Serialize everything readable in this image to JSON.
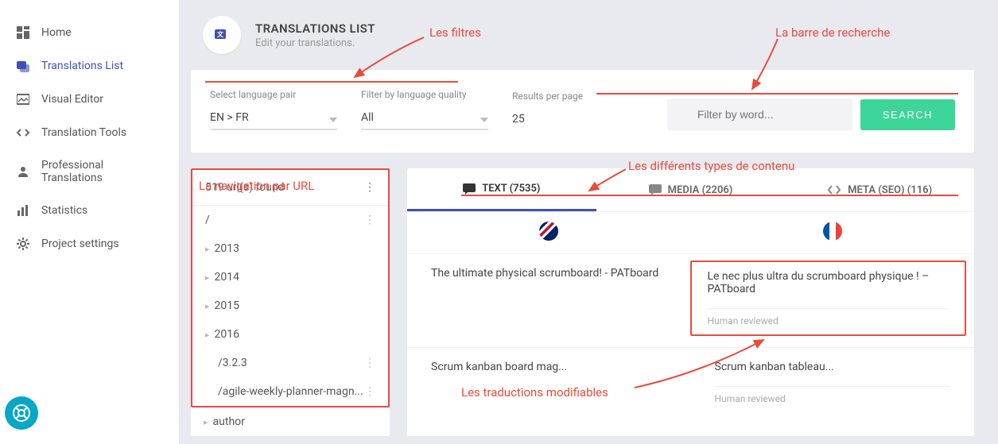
{
  "sidebar": {
    "items": [
      {
        "label": "Home"
      },
      {
        "label": "Translations List"
      },
      {
        "label": "Visual Editor"
      },
      {
        "label": "Translation Tools"
      },
      {
        "label": "Professional Translations"
      },
      {
        "label": "Statistics"
      },
      {
        "label": "Project settings"
      }
    ]
  },
  "header": {
    "title": "TRANSLATIONS LIST",
    "subtitle": "Edit your translations."
  },
  "filters": {
    "language_pair": {
      "label": "Select language pair",
      "value": "EN > FR"
    },
    "quality": {
      "label": "Filter by language quality",
      "value": "All"
    },
    "results": {
      "label": "Results per page",
      "value": "25"
    }
  },
  "search": {
    "placeholder": "Filter by word...",
    "button": "SEARCH"
  },
  "url_nav": {
    "found_label": "519 url(s) found",
    "items": [
      {
        "label": "/",
        "dots": true
      },
      {
        "label": "2013",
        "expandable": true
      },
      {
        "label": "2014",
        "expandable": true
      },
      {
        "label": "2015",
        "expandable": true
      },
      {
        "label": "2016",
        "expandable": true
      },
      {
        "label": "/3.2.3",
        "indented": true,
        "dots": true
      },
      {
        "label": "/agile-weekly-planner-magn...",
        "indented": true,
        "dots": true
      },
      {
        "label": "author",
        "expandable": true,
        "outside": true
      }
    ]
  },
  "tabs": [
    {
      "label": "TEXT (7535)",
      "active": true
    },
    {
      "label": "MEDIA (2206)"
    },
    {
      "label": "META (SEO) (116)"
    }
  ],
  "translations": [
    {
      "source": "The ultimate physical scrumboard! - PATboard",
      "target": "Le nec plus ultra du scrumboard physique ! – PATboard",
      "status": "Human reviewed",
      "highlighted": true
    },
    {
      "source": "Scrum kanban board mag...",
      "target": "Scrum kanban tableau...",
      "status": "Human reviewed"
    }
  ],
  "annotations": {
    "filters": "Les filtres",
    "searchbar": "La barre de recherche",
    "url_nav": "La navigation par URL",
    "content_types": "Les différents types de contenu",
    "editable": "Les traductions modifiables"
  }
}
